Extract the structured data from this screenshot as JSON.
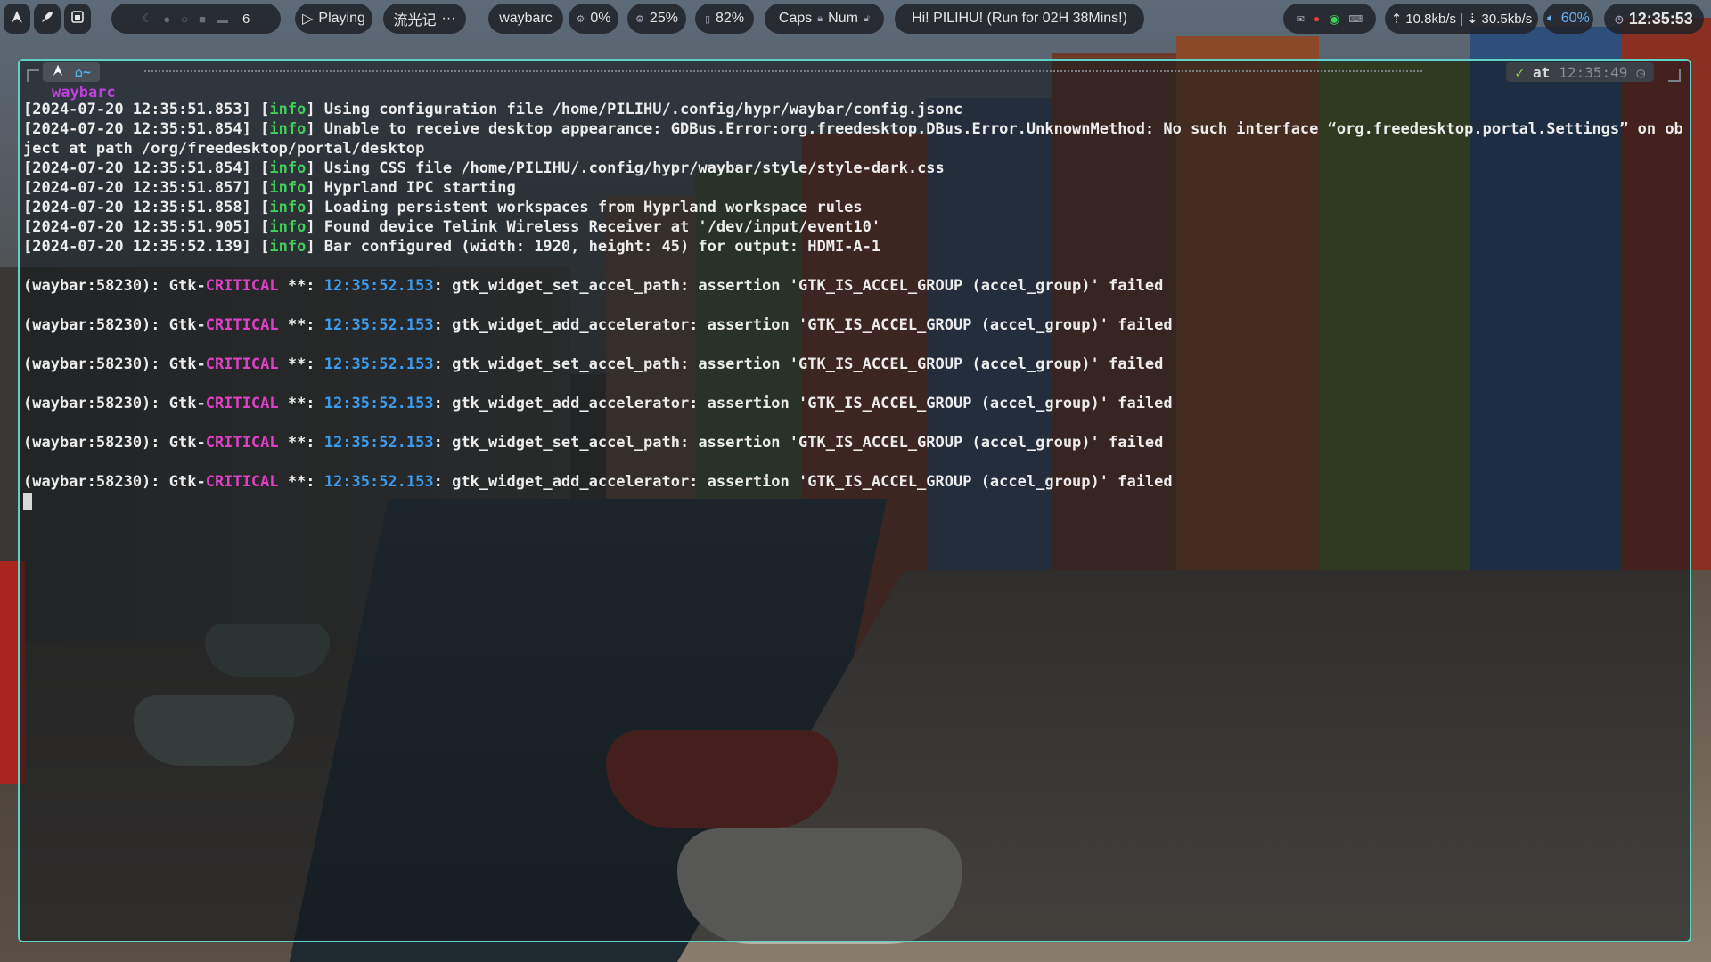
{
  "topbar": {
    "launcher_icon": "arch-logo-icon",
    "rocket_icon": "rocket-icon",
    "screenshot_icon": "screenshot-icon",
    "workspace_icons": [
      "moon-icon",
      "bell-icon",
      "circle-icon",
      "square-icon",
      "monitor-icon"
    ],
    "workspace_number": "6",
    "media_status": "Playing",
    "song_title": "流光记",
    "song_more": "···",
    "active_window": "waybarc",
    "cpu": "0%",
    "memory": "25%",
    "battery": "82%",
    "caps_label": "Caps",
    "num_label": "Num",
    "greeting": "Hi! PILIHU! (Run for 02H 38Mins!)",
    "tray_icons": [
      "mail-icon",
      "record-icon",
      "wechat-icon",
      "keyboard-icon"
    ],
    "net_up": "10.8kb/s",
    "net_down": "30.5kb/s",
    "volume": "60%",
    "clock": "12:35:53"
  },
  "terminal": {
    "prompt": {
      "os_icon": "arch-logo-icon",
      "dir": "~",
      "status_ok": "✓",
      "at_word": "at",
      "time": "12:35:49"
    },
    "command": "waybarc",
    "info_lines": [
      {
        "ts": "[2024-07-20 12:35:51.853]",
        "level": "info",
        "msg": "Using configuration file /home/PILIHU/.config/hypr/waybar/config.jsonc"
      },
      {
        "ts": "[2024-07-20 12:35:51.854]",
        "level": "info",
        "msg": "Unable to receive desktop appearance: GDBus.Error:org.freedesktop.DBus.Error.UnknownMethod: No such interface “org.freedesktop.portal.Settings” on object at path /org/freedesktop/portal/desktop"
      },
      {
        "ts": "[2024-07-20 12:35:51.854]",
        "level": "info",
        "msg": "Using CSS file /home/PILIHU/.config/hypr/waybar/style/style-dark.css"
      },
      {
        "ts": "[2024-07-20 12:35:51.857]",
        "level": "info",
        "msg": "Hyprland IPC starting"
      },
      {
        "ts": "[2024-07-20 12:35:51.858]",
        "level": "info",
        "msg": "Loading persistent workspaces from Hyprland workspace rules"
      },
      {
        "ts": "[2024-07-20 12:35:51.905]",
        "level": "info",
        "msg": "Found device Telink Wireless Receiver at '/dev/input/event10'"
      },
      {
        "ts": "[2024-07-20 12:35:52.139]",
        "level": "info",
        "msg": "Bar configured (width: 1920, height: 45) for output: HDMI-A-1"
      }
    ],
    "critical_lines": [
      {
        "prefix": "(waybar:58230): Gtk-",
        "level": "CRITICAL",
        "sep": " **: ",
        "time": "12:35:52.153",
        "msg": ": gtk_widget_set_accel_path: assertion 'GTK_IS_ACCEL_GROUP (accel_group)' failed"
      },
      {
        "prefix": "(waybar:58230): Gtk-",
        "level": "CRITICAL",
        "sep": " **: ",
        "time": "12:35:52.153",
        "msg": ": gtk_widget_add_accelerator: assertion 'GTK_IS_ACCEL_GROUP (accel_group)' failed"
      },
      {
        "prefix": "(waybar:58230): Gtk-",
        "level": "CRITICAL",
        "sep": " **: ",
        "time": "12:35:52.153",
        "msg": ": gtk_widget_set_accel_path: assertion 'GTK_IS_ACCEL_GROUP (accel_group)' failed"
      },
      {
        "prefix": "(waybar:58230): Gtk-",
        "level": "CRITICAL",
        "sep": " **: ",
        "time": "12:35:52.153",
        "msg": ": gtk_widget_add_accelerator: assertion 'GTK_IS_ACCEL_GROUP (accel_group)' failed"
      },
      {
        "prefix": "(waybar:58230): Gtk-",
        "level": "CRITICAL",
        "sep": " **: ",
        "time": "12:35:52.153",
        "msg": ": gtk_widget_set_accel_path: assertion 'GTK_IS_ACCEL_GROUP (accel_group)' failed"
      },
      {
        "prefix": "(waybar:58230): Gtk-",
        "level": "CRITICAL",
        "sep": " **: ",
        "time": "12:35:52.153",
        "msg": ": gtk_widget_add_accelerator: assertion 'GTK_IS_ACCEL_GROUP (accel_group)' failed"
      }
    ]
  },
  "colors": {
    "terminal_border": "#5fd1c4",
    "info": "#3fd15a",
    "critical": "#e040c8",
    "timestamp": "#3b9cf0",
    "command": "#c040e0"
  }
}
